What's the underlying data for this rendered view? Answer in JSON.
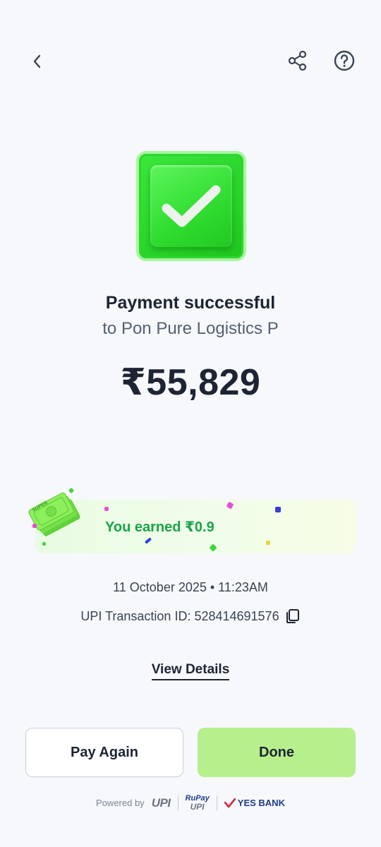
{
  "header": {
    "back_icon": "chevron-left-icon",
    "share_icon": "share-icon",
    "help_icon": "help-circle-icon"
  },
  "status": {
    "icon": "check-icon",
    "title": "Payment successful",
    "payee": "to Pon Pure Logistics P",
    "amount": "₹55,829"
  },
  "reward": {
    "text": "You earned ₹0.9",
    "badge_text": "SUPER"
  },
  "transaction": {
    "datetime": "11 October 2025 • 11:23AM",
    "upi_id_label": "UPI Transaction ID: 528414691576"
  },
  "links": {
    "view_details": "View Details"
  },
  "actions": {
    "pay_again": "Pay Again",
    "done": "Done"
  },
  "footer": {
    "powered_by": "Powered by",
    "upi": "UPI",
    "rupay": "RuPay",
    "rupay_upi": "UPI",
    "bank": "YES BANK"
  },
  "colors": {
    "background": "#f6f8fb",
    "success_green": "#2fdc2f",
    "reward_text": "#1aa34a",
    "done_button": "#b7ef8d",
    "text_primary": "#1d2433",
    "text_secondary": "#556072"
  }
}
